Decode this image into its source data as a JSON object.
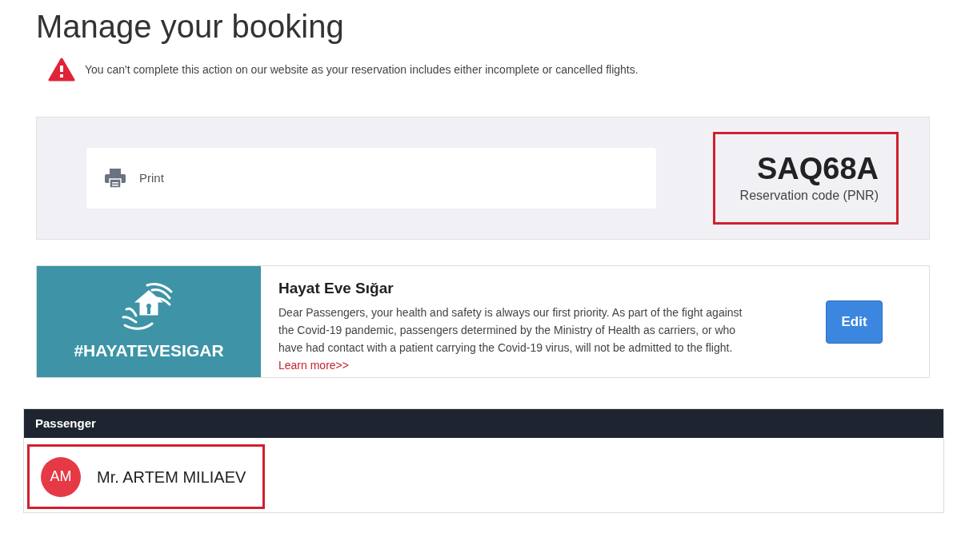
{
  "title": "Manage your booking",
  "alert": {
    "text": "You can't complete this action on our website as your reservation includes either incomplete or cancelled flights."
  },
  "actions": [
    {
      "label": "Print"
    }
  ],
  "reservation": {
    "code": "SAQ68A",
    "label": "Reservation code (PNR)",
    "highlighted": true
  },
  "notice": {
    "banner_text": "#HAYATEVESIGAR",
    "title": "Hayat Eve Sığar",
    "body": "Dear Passengers, your health and safety is always our first priority. As part of the fight against the Covid-19 pandemic, passengers determined by the Ministry of Health as carriers, or who have had contact with a patient carrying the Covid-19 virus, will not be admitted to the flight.",
    "link": "Learn more>>",
    "button": "Edit"
  },
  "passengers": {
    "heading": "Passenger",
    "items": [
      {
        "initials": "AM",
        "name": "Mr. ARTEM MILIAEV",
        "highlighted": true
      }
    ]
  }
}
